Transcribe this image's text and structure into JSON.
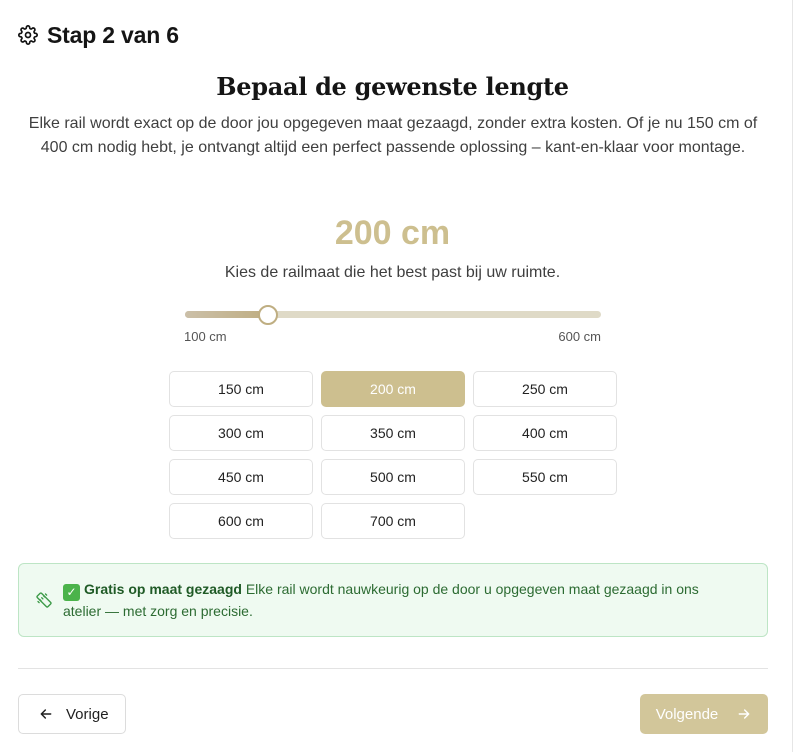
{
  "header": {
    "step_title": "Stap 2 van 6",
    "icon": "gear-icon"
  },
  "section": {
    "title": "Bepaal de gewenste lengte",
    "description": "Elke rail wordt exact op de door jou opgegeven maat gezaagd, zonder extra kosten. Of je nu 150 cm of 400 cm nodig hebt, je ontvangt altijd een perfect passende oplossing – kant-en-klaar voor montage."
  },
  "length": {
    "value_display": "200 cm",
    "hint": "Kies de railmaat die het best past bij uw ruimte.",
    "slider_value": 200,
    "slider_min": 100,
    "slider_max": 600,
    "slider_min_label": "100 cm",
    "slider_max_label": "600 cm",
    "accent_color": "#cdbf8f"
  },
  "sizes": {
    "options": [
      {
        "label": "150 cm",
        "selected": false
      },
      {
        "label": "200 cm",
        "selected": true
      },
      {
        "label": "250 cm",
        "selected": false
      },
      {
        "label": "300 cm",
        "selected": false
      },
      {
        "label": "350 cm",
        "selected": false
      },
      {
        "label": "400 cm",
        "selected": false
      },
      {
        "label": "450 cm",
        "selected": false
      },
      {
        "label": "500 cm",
        "selected": false
      },
      {
        "label": "550 cm",
        "selected": false
      },
      {
        "label": "600 cm",
        "selected": false
      },
      {
        "label": "700 cm",
        "selected": false
      }
    ]
  },
  "info": {
    "icon": "ruler-icon",
    "check_icon": "check-mark-icon",
    "strong": "Gratis op maat gezaagd",
    "text": " Elke rail wordt nauwkeurig op de door u opgegeven maat gezaagd in ons atelier — met zorg en precisie."
  },
  "nav": {
    "prev_label": "Vorige",
    "prev_icon": "arrow-left-icon",
    "next_label": "Volgende",
    "next_icon": "arrow-right-icon",
    "next_color": "#d2c69a"
  }
}
